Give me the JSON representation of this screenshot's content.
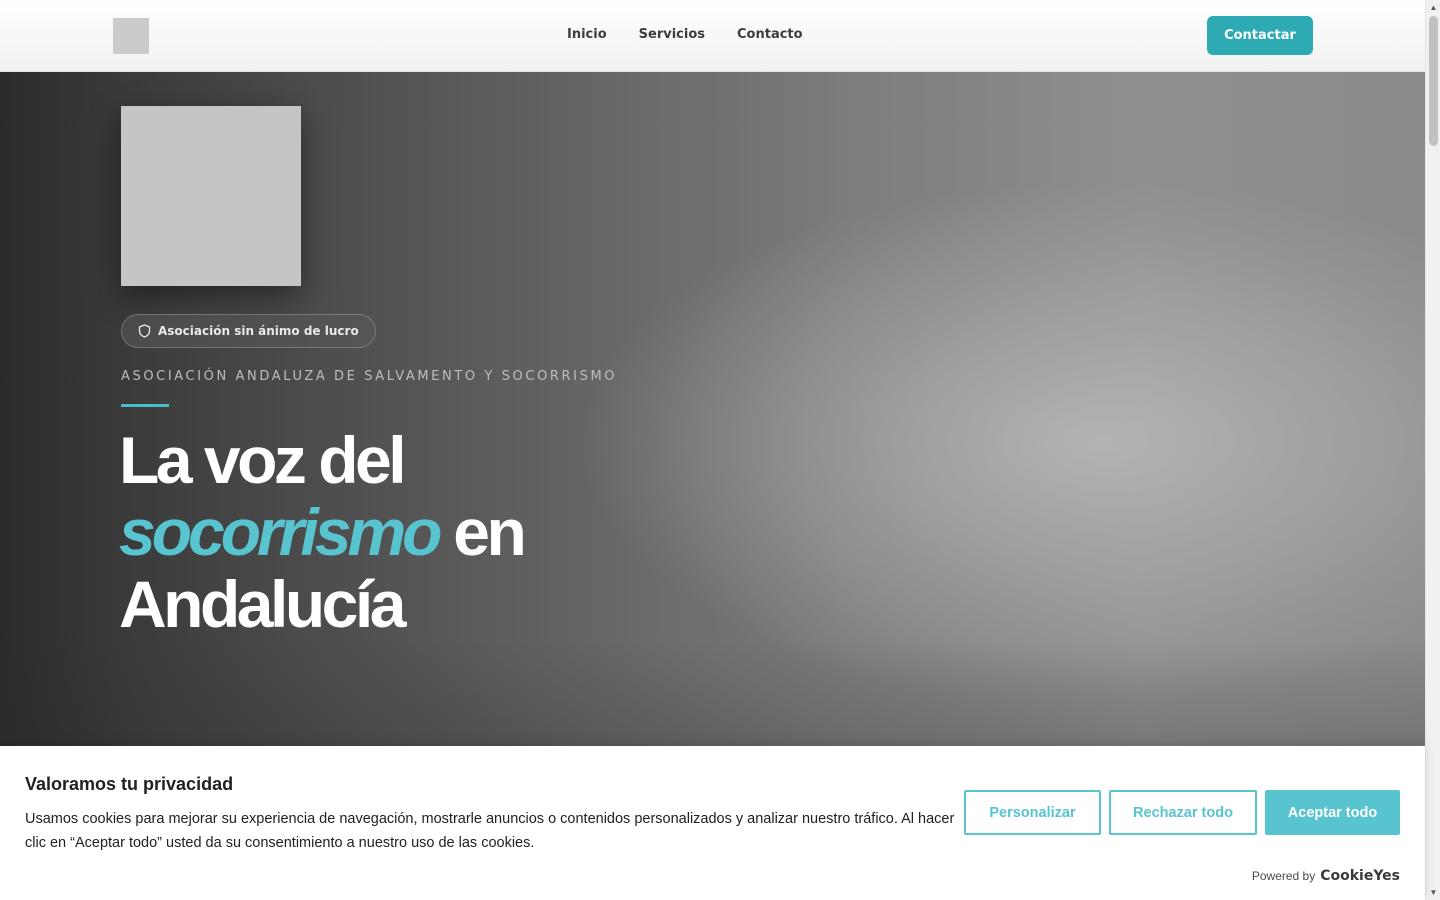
{
  "header": {
    "nav": [
      "Inicio",
      "Servicios",
      "Contacto"
    ],
    "cta_label": "Contactar"
  },
  "hero": {
    "badge_label": "Asociación sin ánimo de lucro",
    "kicker": "ASOCIACIÓN ANDALUZA DE SALVAMENTO Y SOCORRISMO",
    "headline": {
      "line1": "La voz del",
      "accent": "socorrismo",
      "after_accent": " en",
      "line3": "Andalucía"
    },
    "accent_color": "#57c4cf"
  },
  "cookie_banner": {
    "title": "Valoramos tu privacidad",
    "text": "Usamos cookies para mejorar su experiencia de navegación, mostrarle anuncios o contenidos personalizados y analizar nuestro tráfico. Al hacer clic en “Aceptar todo” usted da su consentimiento a nuestro uso de las cookies.",
    "buttons": {
      "customize": "Personalizar",
      "reject": "Rechazar todo",
      "accept": "Aceptar todo"
    },
    "powered_label": "Powered by",
    "powered_brand": "CookieYes"
  },
  "colors": {
    "brand": "#2eaab5",
    "accent": "#57c4cf"
  },
  "icons": {
    "badge": "shield-icon"
  }
}
